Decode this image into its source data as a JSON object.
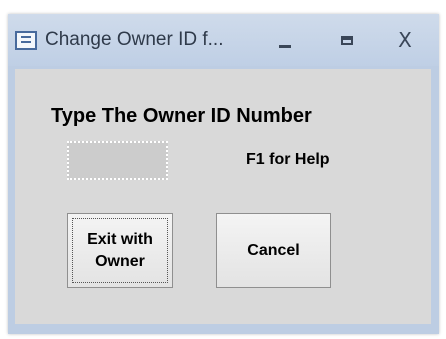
{
  "window": {
    "title": "Change Owner ID f...",
    "icon": "form-icon",
    "controls": {
      "minimize_icon": "minimize-icon",
      "maximize_icon": "maximize-icon",
      "close_glyph": "X"
    }
  },
  "form": {
    "heading": "Type The Owner ID Number",
    "owner_id_value": "",
    "help_text": "F1 for Help",
    "buttons": {
      "exit_label": "Exit with\nOwner",
      "cancel_label": "Cancel"
    }
  },
  "colors": {
    "frame": "#bdcde3",
    "client_background": "#d9d9d9",
    "field_background": "#cccccc"
  }
}
